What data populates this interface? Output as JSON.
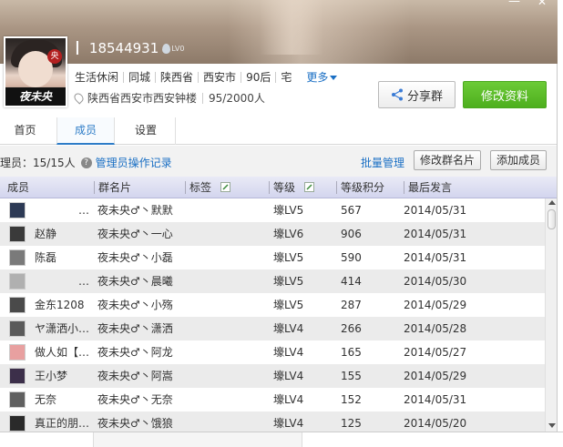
{
  "window": {
    "minimize_label": "—",
    "close_label": "✕"
  },
  "profile": {
    "avatar_caption": "夜未央",
    "avatar_seal": "央",
    "cursor_mark": "I",
    "group_id": "18544931",
    "level_badge": "LV0",
    "tags": [
      "生活休闲",
      "同城",
      "陕西省",
      "西安市",
      "90后",
      "宅"
    ],
    "more_label": "更多",
    "location": "陕西省西安市西安钟楼",
    "member_count": "95/2000人"
  },
  "actions": {
    "share_label": "分享群",
    "edit_label": "修改资料"
  },
  "tabs": [
    {
      "label": "首页"
    },
    {
      "label": "成员"
    },
    {
      "label": "设置"
    }
  ],
  "toolbar": {
    "admin_count": "理员：15/15人",
    "admin_log": "管理员操作记录",
    "batch_label": "批量管理",
    "edit_card_label": "修改群名片",
    "add_member_label": "添加成员"
  },
  "columns": [
    "成员",
    "群名片",
    "标签",
    "等级",
    "等级积分",
    "最后发言"
  ],
  "rows": [
    {
      "member": "…",
      "card": "夜未央♂丶默默",
      "tag": "",
      "level": "壕LV5",
      "points": "567",
      "last": "2014/05/31",
      "avatar_color": "#2d3a55"
    },
    {
      "member": "赵静",
      "card": "夜未央♂丶一心",
      "tag": "",
      "level": "壕LV6",
      "points": "906",
      "last": "2014/05/31",
      "avatar_color": "#3a3a3a"
    },
    {
      "member": "陈磊",
      "card": "夜未央♂丶小磊",
      "tag": "",
      "level": "壕LV5",
      "points": "590",
      "last": "2014/05/31",
      "avatar_color": "#7a7a7a"
    },
    {
      "member": "…",
      "card": "夜未央♂丶晨曦",
      "tag": "",
      "level": "壕LV5",
      "points": "414",
      "last": "2014/05/30",
      "avatar_color": "#b0b0b0"
    },
    {
      "member": "金东1208",
      "card": "夜未央♂丶小殇",
      "tag": "",
      "level": "壕LV5",
      "points": "287",
      "last": "2014/05/29",
      "avatar_color": "#4a4a4a"
    },
    {
      "member": "ヤ潇洒小…",
      "card": "夜未央♂丶潇洒",
      "tag": "",
      "level": "壕LV4",
      "points": "266",
      "last": "2014/05/28",
      "avatar_color": "#5a5a5a"
    },
    {
      "member": "做人如【…",
      "card": "夜未央♂丶阿龙",
      "tag": "",
      "level": "壕LV4",
      "points": "165",
      "last": "2014/05/27",
      "avatar_color": "#e8a0a0"
    },
    {
      "member": "王小梦",
      "card": "夜未央♂丶阿嵩",
      "tag": "",
      "level": "壕LV4",
      "points": "155",
      "last": "2014/05/29",
      "avatar_color": "#3c2f4a"
    },
    {
      "member": "无奈",
      "card": "夜未央♂丶无奈",
      "tag": "",
      "level": "壕LV4",
      "points": "152",
      "last": "2014/05/31",
      "avatar_color": "#606060"
    },
    {
      "member": "真正的朋…",
      "card": "夜未央♂丶饿狼",
      "tag": "",
      "level": "壕LV4",
      "points": "125",
      "last": "2014/05/20",
      "avatar_color": "#2a2a2a"
    }
  ]
}
